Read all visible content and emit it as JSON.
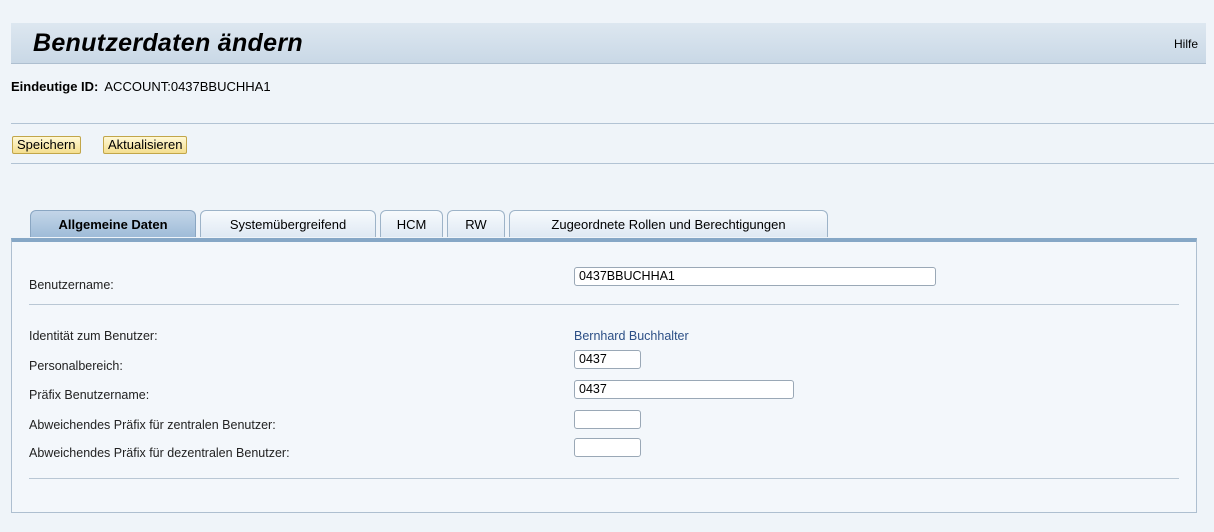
{
  "header": {
    "title": "Benutzerdaten ändern",
    "help": "Hilfe"
  },
  "id_line": {
    "label": "Eindeutige ID:",
    "value": "ACCOUNT:0437BBUCHHA1"
  },
  "toolbar": {
    "save_label": "Speichern",
    "refresh_label": "Aktualisieren"
  },
  "tabs": [
    {
      "label": "Allgemeine Daten",
      "active": true
    },
    {
      "label": "Systemübergreifend",
      "active": false
    },
    {
      "label": "HCM",
      "active": false
    },
    {
      "label": "RW",
      "active": false
    },
    {
      "label": "Zugeordnete Rollen und Berechtigungen",
      "active": false
    }
  ],
  "form": {
    "username_label": "Benutzername:",
    "username_value": "0437BBUCHHA1",
    "identity_label": "Identität zum Benutzer:",
    "identity_value": "Bernhard Buchhalter",
    "personnel_area_label": "Personalbereich:",
    "personnel_area_value": "0437",
    "prefix_label": "Präfix Benutzername:",
    "prefix_value": "0437",
    "central_prefix_label": "Abweichendes Präfix für zentralen Benutzer:",
    "central_prefix_value": "",
    "decentral_prefix_label": "Abweichendes Präfix für dezentralen Benutzer:",
    "decentral_prefix_value": ""
  },
  "colors": {
    "accent": "#86a7c6",
    "button_bg": "#f4de8f",
    "link": "#2c4f86"
  }
}
